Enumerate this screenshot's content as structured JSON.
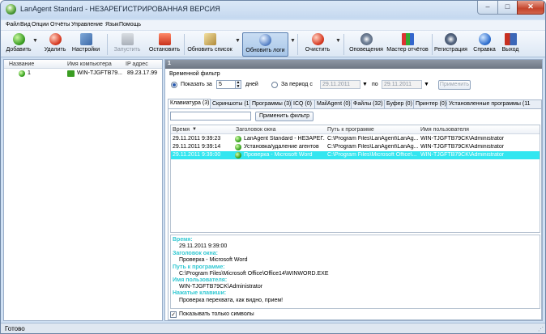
{
  "window": {
    "title": "LanAgent Standard - НЕЗАРЕГИСТРИРОВАННАЯ ВЕРСИЯ",
    "minimize": "–",
    "maximize": "□",
    "close": "✕"
  },
  "menu": [
    "Файл",
    "Вид",
    "Опции",
    "Отчёты",
    "Управление",
    "Язык",
    "Помощь"
  ],
  "toolbar": {
    "add": "Добавить",
    "delete": "Удалить",
    "settings": "Настройки",
    "start": "Запустить",
    "stop": "Остановить",
    "refresh_list": "Обновить список",
    "refresh_logs": "Обновить логи",
    "clear": "Очистить",
    "alerts": "Оповещения",
    "reports_wizard": "Мастер отчётов",
    "register": "Регистрация",
    "help": "Справка",
    "exit": "Выход",
    "dropdown": "▼"
  },
  "left_panel": {
    "columns": [
      "Название",
      "Имя компьютера",
      "IP адрес"
    ],
    "rows": [
      {
        "name": "1",
        "computer": "WIN-TJGFTB79...",
        "ip": "89.23.17.99"
      }
    ]
  },
  "right_panel": {
    "header": "1",
    "filter_title": "Временной фильтр",
    "show_for": "Показать за",
    "days_value": "5",
    "days": "дней",
    "period_from": "За период с",
    "date_from": "29.11.2011",
    "to": "по",
    "date_to": "29.11.2011",
    "apply": "Применить",
    "tabs": [
      "Клавиатура (3)",
      "Скриншоты (1)",
      "Программы (3)",
      "ICQ (0)",
      "MailAgent (0)",
      "Файлы (32)",
      "Буфер (0)",
      "Принтер (0)",
      "Установленные программы (11"
    ],
    "apply_filter": "Применить фильтр",
    "grid_columns": [
      "Время",
      "Заголовок окна",
      "Путь к программе",
      "Имя пользователя"
    ],
    "grid_rows": [
      {
        "time": "29.11.2011 9:39:23",
        "title": "LanAgent Standard - НЕЗАРЕГ...",
        "path": "C:\\Program Files\\LanAgent\\LanAg...",
        "user": "WIN-TJGFTB79CK\\Administrator"
      },
      {
        "time": "29.11.2011 9:39:14",
        "title": "Установка/удаление агентов",
        "path": "C:\\Program Files\\LanAgent\\LanAg...",
        "user": "WIN-TJGFTB79CK\\Administrator"
      },
      {
        "time": "29.11.2011 9:39:00",
        "title": "Проверка - Microsoft Word",
        "path": "C:\\Program Files\\Microsoft Office\\...",
        "user": "WIN-TJGFTB79CK\\Administrator"
      }
    ],
    "details": {
      "time_label": "Время:",
      "time_value": "29.11.2011 9:39:00",
      "title_label": "Заголовок окна:",
      "title_value": "Проверка - Microsoft Word",
      "path_label": "Путь к программе:",
      "path_value": "C:\\Program Files\\Microsoft Office\\Office14\\WINWORD.EXE",
      "user_label": "Имя пользователя:",
      "user_value": "WIN-TJGFTB79CK\\Administrator",
      "keys_label": "Нажатые клавиши:",
      "keys_value": "Проверка перехвата, как видно, прием!"
    },
    "show_symbols_only": "Показывать только символы"
  },
  "status": {
    "text": "Готово",
    "grip": "⋰"
  },
  "colors": {
    "accent": "#2a5bb0",
    "selection": "#33e6f0",
    "detail_label": "#32c8d2"
  }
}
